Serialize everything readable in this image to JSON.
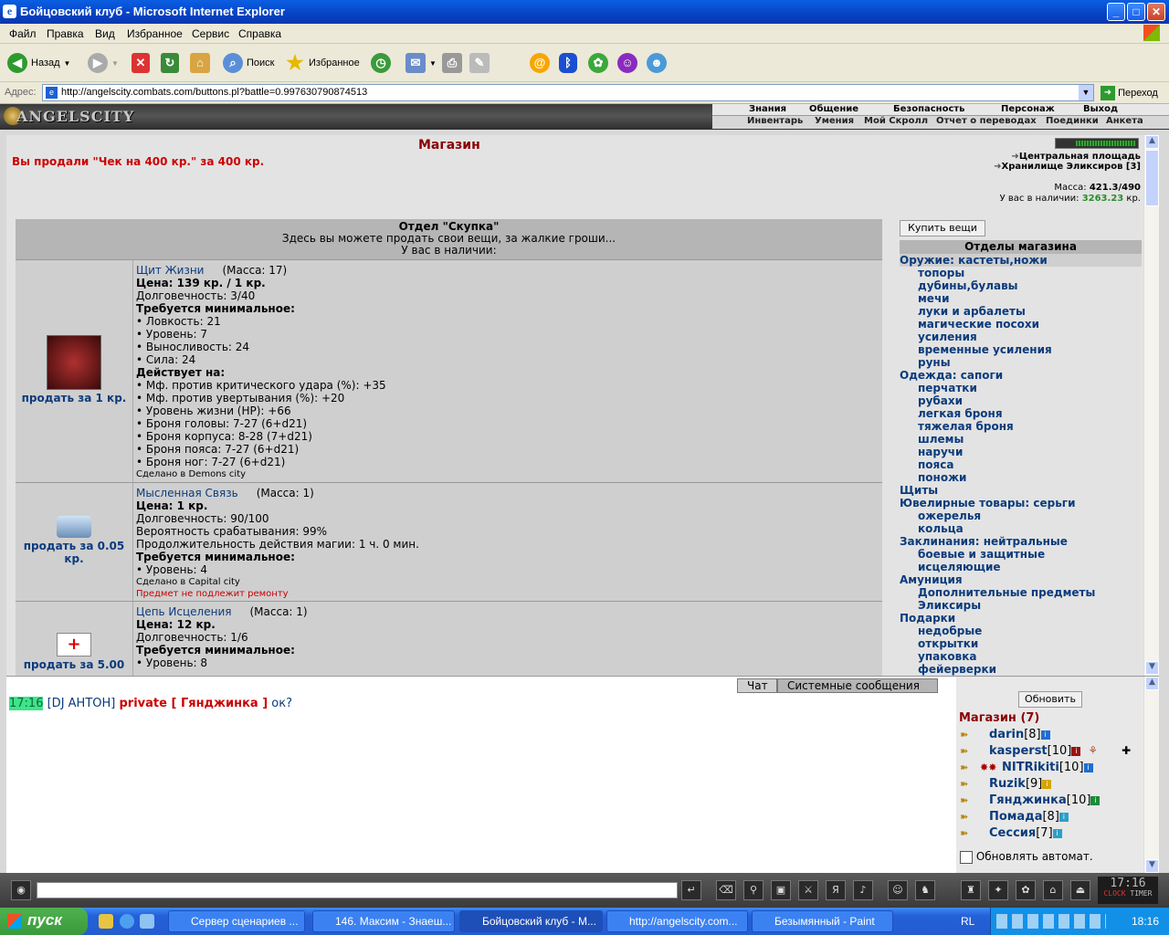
{
  "window": {
    "title": "Бойцовский клуб - Microsoft Internet Explorer"
  },
  "menu": [
    "Файл",
    "Правка",
    "Вид",
    "Избранное",
    "Сервис",
    "Справка"
  ],
  "toolbar": {
    "back": "Назад",
    "search": "Поиск",
    "favorites": "Избранное"
  },
  "address": {
    "label": "Адрес:",
    "url": "http://angelscity.combats.com/buttons.pl?battle=0.997630790874513",
    "go": "Переход"
  },
  "site": {
    "logo": "ANGELSCITY",
    "nav_top": [
      "Знания",
      "Общение",
      "Безопасность",
      "Персонаж",
      "Выход"
    ],
    "nav_bottom": [
      "Инвентарь",
      "Умения",
      "Мой Скролл",
      "Отчет о переводах",
      "Поединки",
      "Анкета"
    ]
  },
  "shop": {
    "title": "Магазин",
    "sold_msg": "Вы продали \"Чек на 400 кр.\" за 400 кр.",
    "locations": [
      "Центральная площадь",
      "Хранилище Эликсиров [3]"
    ],
    "mass_label": "Масса:",
    "mass_value": "421.3/490",
    "cash_label": "У вас в наличии:",
    "cash_value": "3263.23",
    "cash_unit": "кр.",
    "dept_title": "Отдел \"Скупка\"",
    "dept_sub": "Здесь вы можете продать свои вещи, за жалкие гроши...",
    "dept_have": "У вас в наличии:",
    "buy_button": "Купить вещи",
    "cats_header": "Отделы магазина",
    "categories": [
      {
        "label": "Оружие: кастеты,ножи",
        "sub": false
      },
      {
        "label": "топоры",
        "sub": true
      },
      {
        "label": "дубины,булавы",
        "sub": true
      },
      {
        "label": "мечи",
        "sub": true
      },
      {
        "label": "луки и арбалеты",
        "sub": true
      },
      {
        "label": "магические посохи",
        "sub": true
      },
      {
        "label": "усиления",
        "sub": true
      },
      {
        "label": "временные усиления",
        "sub": true
      },
      {
        "label": "руны",
        "sub": true
      },
      {
        "label": "Одежда: сапоги",
        "sub": false
      },
      {
        "label": "перчатки",
        "sub": true
      },
      {
        "label": "рубахи",
        "sub": true
      },
      {
        "label": "легкая броня",
        "sub": true
      },
      {
        "label": "тяжелая броня",
        "sub": true
      },
      {
        "label": "шлемы",
        "sub": true
      },
      {
        "label": "наручи",
        "sub": true
      },
      {
        "label": "пояса",
        "sub": true
      },
      {
        "label": "поножи",
        "sub": true
      },
      {
        "label": "Щиты",
        "sub": false
      },
      {
        "label": "Ювелирные товары: серьги",
        "sub": false
      },
      {
        "label": "ожерелья",
        "sub": true
      },
      {
        "label": "кольца",
        "sub": true
      },
      {
        "label": "Заклинания: нейтральные",
        "sub": false
      },
      {
        "label": "боевые и защитные",
        "sub": true
      },
      {
        "label": "исцеляющие",
        "sub": true
      },
      {
        "label": "Амуниция",
        "sub": false
      },
      {
        "label": "Дополнительные предметы",
        "sub": true
      },
      {
        "label": "Эликсиры",
        "sub": true
      },
      {
        "label": "Подарки",
        "sub": false
      },
      {
        "label": "недобрые",
        "sub": true
      },
      {
        "label": "открытки",
        "sub": true
      },
      {
        "label": "упаковка",
        "sub": true
      },
      {
        "label": "фейерверки",
        "sub": true
      }
    ],
    "items": [
      {
        "name": "Щит Жизни",
        "mass": "(Масса: 17)",
        "sell": "продать за 1 кр.",
        "lines": [
          {
            "t": "Цена: 139 кр. / 1 кр.",
            "b": true
          },
          {
            "t": "Долговечность: 3/40"
          },
          {
            "t": "Требуется минимальное:",
            "b": true
          },
          {
            "t": "• Ловкость: 21"
          },
          {
            "t": "• Уровень: 7"
          },
          {
            "t": "• Выносливость: 24"
          },
          {
            "t": "• Сила: 24"
          },
          {
            "t": "Действует на:",
            "b": true
          },
          {
            "t": "• Мф. против критического удара (%): +35"
          },
          {
            "t": "• Мф. против увертывания (%): +20"
          },
          {
            "t": "• Уровень жизни (HP): +66"
          },
          {
            "t": "• Броня головы: 7-27 (6+d21)"
          },
          {
            "t": "• Броня корпуса: 8-28 (7+d21)"
          },
          {
            "t": "• Броня пояса: 7-27 (6+d21)"
          },
          {
            "t": "• Броня ног: 7-27 (6+d21)"
          },
          {
            "t": "Сделано в Demons city",
            "s": true
          }
        ]
      },
      {
        "name": "Мысленная Связь",
        "mass": "(Масса: 1)",
        "sell": "продать за 0.05 кр.",
        "lines": [
          {
            "t": "Цена: 1 кр.",
            "b": true
          },
          {
            "t": "Долговечность: 90/100"
          },
          {
            "t": "Вероятность срабатывания: 99%"
          },
          {
            "t": "Продолжительность действия магии: 1 ч. 0 мин."
          },
          {
            "t": "Требуется минимальное:",
            "b": true
          },
          {
            "t": "• Уровень: 4"
          },
          {
            "t": "Сделано в Capital city",
            "s": true
          },
          {
            "t": "Предмет не подлежит ремонту",
            "s": true,
            "r": true
          }
        ]
      },
      {
        "name": "Цепь Исцеления",
        "mass": "(Масса: 1)",
        "sell": "продать за 5.00",
        "lines": [
          {
            "t": "Цена: 12 кр.",
            "b": true
          },
          {
            "t": "Долговечность: 1/6"
          },
          {
            "t": "Требуется минимальное:",
            "b": true
          },
          {
            "t": "• Уровень: 8"
          }
        ]
      }
    ]
  },
  "chat": {
    "tab_chat": "Чат",
    "tab_sys": "Системные сообщения",
    "time": "17:16",
    "from": "[DJ АНТОН]",
    "private": "private [ Гянджинка ]",
    "text": "ок?"
  },
  "online": {
    "refresh": "Обновить",
    "header": "Магазин (7)",
    "users": [
      {
        "name": "darin",
        "lvl": "[8]"
      },
      {
        "name": "kasperst",
        "lvl": "[10]"
      },
      {
        "name": "NITRikiti",
        "lvl": "[10]"
      },
      {
        "name": "Ruzik",
        "lvl": "[9]"
      },
      {
        "name": "Гянджинка",
        "lvl": "[10]"
      },
      {
        "name": "Помада",
        "lvl": "[8]"
      },
      {
        "name": "Сессия",
        "lvl": "[7]"
      }
    ],
    "auto": "Обновлять автомат."
  },
  "clock": {
    "time": "17:16",
    "label1": "CLOCK",
    "label2": "TIMER"
  },
  "taskbar": {
    "start": "пуск",
    "tasks": [
      "Сервер сценариев ...",
      "146. Максим - Знаеш...",
      "Бойцовский клуб - M...",
      "http://angelscity.com...",
      "Безымянный - Paint"
    ],
    "lang": "RL",
    "time": "18:16"
  }
}
